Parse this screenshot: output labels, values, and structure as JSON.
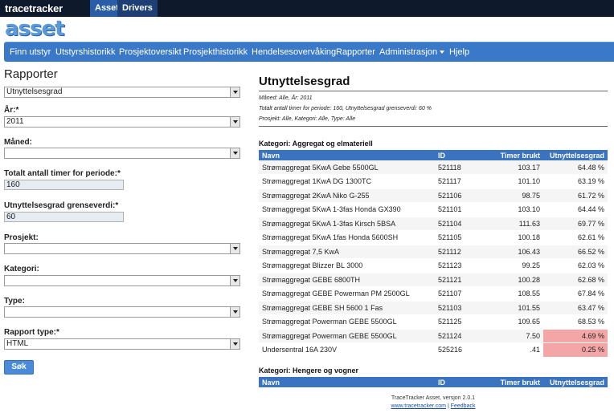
{
  "topbar": {
    "brand": "tracetracker",
    "tabs": [
      "Asset",
      "Drivers"
    ]
  },
  "logo": "asset",
  "nav": {
    "items": [
      "Finn utstyr",
      "Utstyrshistorikk",
      "Prosjektoversikt",
      "Prosjekthistorikk",
      "Hendelsesovervåking",
      "Rapporter",
      "Administrasjon",
      "Hjelp"
    ]
  },
  "form": {
    "title": "Rapporter",
    "report_select": "Utnyttelsesgrad",
    "year_label": "År:*",
    "year_value": "2011",
    "month_label": "Måned:",
    "month_value": "",
    "total_hours_label": "Totalt antall timer for periode:*",
    "total_hours_value": "160",
    "threshold_label": "Utnyttelsesgrad grenseverdi:*",
    "threshold_value": "60",
    "project_label": "Prosjekt:",
    "project_value": "",
    "category_label": "Kategori:",
    "category_value": "",
    "type_label": "Type:",
    "type_value": "",
    "report_type_label": "Rapport type:*",
    "report_type_value": "HTML",
    "submit_label": "Søk"
  },
  "report": {
    "title": "Utnyttelsesgrad",
    "meta1": "Måned: Alle, År: 2011",
    "meta2": "Totalt antall timer for periode: 160, Utnyttelsesgrad grenseverdi: 60 %",
    "meta3": "Prosjekt: Alle, Kategori: Alle, Type: Alle",
    "columns": [
      "Navn",
      "ID",
      "Timer brukt",
      "Utnyttelsesgrad"
    ],
    "category1": "Kategori: Aggregat og elmateriell",
    "rows": [
      {
        "name": "Strømaggregat 5KwA Gebe 5500GL",
        "id": "521118",
        "hours": "103.17",
        "util": "64.48 %",
        "below": false
      },
      {
        "name": "Strømaggregat 1KwA DG 1300TC",
        "id": "521117",
        "hours": "101.10",
        "util": "63.19 %",
        "below": false
      },
      {
        "name": "Strømaggregat 2KwA Niko G-255",
        "id": "521106",
        "hours": "98.75",
        "util": "61.72 %",
        "below": false
      },
      {
        "name": "Strømaggregat 5KwA 1-3fas Honda GX390",
        "id": "521101",
        "hours": "103.10",
        "util": "64.44 %",
        "below": false
      },
      {
        "name": "Strømaggregat 5KwA 1-3fas Kirsch 5BSA",
        "id": "521104",
        "hours": "111.63",
        "util": "69.77 %",
        "below": false
      },
      {
        "name": "Strømaggregat 5KwA 1fas Honda 5600SH",
        "id": "521105",
        "hours": "100.18",
        "util": "62.61 %",
        "below": false
      },
      {
        "name": "Strømaggregat 7,5 KwA",
        "id": "521112",
        "hours": "106.43",
        "util": "66.52 %",
        "below": false
      },
      {
        "name": "Strømaggregat Blizzer BL 3000",
        "id": "521123",
        "hours": "99.25",
        "util": "62.03 %",
        "below": false
      },
      {
        "name": "Strømaggregat GEBE 6800TH",
        "id": "521121",
        "hours": "100.28",
        "util": "62.68 %",
        "below": false
      },
      {
        "name": "Strømaggregat GEBE Powerman PM 2500GL",
        "id": "521107",
        "hours": "108.55",
        "util": "67.84 %",
        "below": false
      },
      {
        "name": "Strømaggregat GEBE SH 5600 1 Fas",
        "id": "521103",
        "hours": "101.55",
        "util": "63.47 %",
        "below": false
      },
      {
        "name": "Strømaggregat Powerman GEBE 5500GL",
        "id": "521125",
        "hours": "109.65",
        "util": "68.53 %",
        "below": false
      },
      {
        "name": "Strømaggregat Powerman GEBE 5500GL",
        "id": "521124",
        "hours": "7.50",
        "util": "4.69 %",
        "below": true
      },
      {
        "name": "Undersentral 16A 230V",
        "id": "525216",
        "hours": ".41",
        "util": "0.25 %",
        "below": true
      }
    ],
    "category2": "Kategori: Hengere og vogner",
    "highlight_color": "#f4a6a6"
  },
  "footer": {
    "version": "TraceTracker Asset, versjon 2.0.1",
    "link": "www.tracetracker.com",
    "separator": " | ",
    "feedback": "Feedback"
  }
}
